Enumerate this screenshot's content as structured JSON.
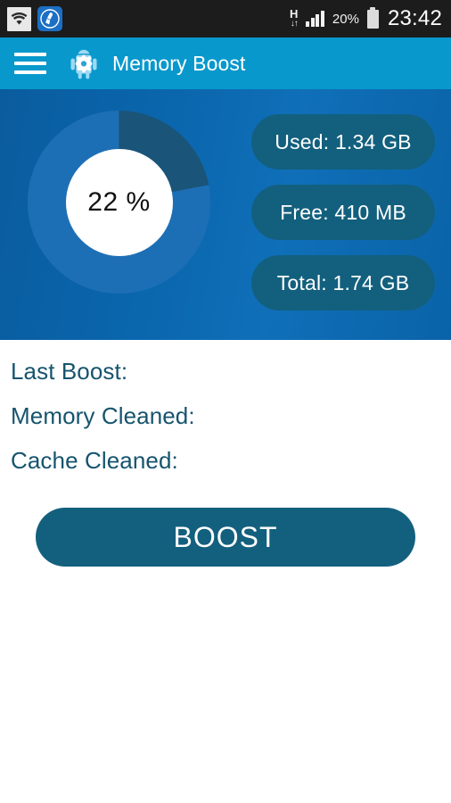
{
  "statusbar": {
    "wifi_icon": "wifi-icon",
    "cleaner_icon": "cleaner-app-icon",
    "data_type": "H",
    "data_arrows": "↓↑",
    "signal_icon": "signal-bars-icon",
    "battery_percent": "20%",
    "battery_icon": "battery-icon",
    "clock": "23:42"
  },
  "appbar": {
    "menu_icon": "hamburger-menu-icon",
    "app_icon": "android-gear-icon",
    "title": "Memory Boost",
    "background_color": "#0898cc"
  },
  "hero": {
    "background_color": "#0a66ad",
    "donut": {
      "percent_label": "22 %",
      "used_color": "#1a5479",
      "free_color": "#1d6fb5",
      "hole_color": "#ffffff"
    },
    "stats": [
      {
        "name": "used",
        "label": "Used: 1.34 GB"
      },
      {
        "name": "free",
        "label": "Free: 410 MB"
      },
      {
        "name": "total",
        "label": "Total: 1.74 GB"
      }
    ],
    "pill_color": "#13607e"
  },
  "info": {
    "rows": [
      {
        "name": "last-boost",
        "label": "Last Boost:",
        "value": ""
      },
      {
        "name": "memory-cleaned",
        "label": "Memory Cleaned:",
        "value": ""
      },
      {
        "name": "cache-cleaned",
        "label": "Cache Cleaned:",
        "value": ""
      }
    ],
    "text_color": "#16546e"
  },
  "actions": {
    "boost_label": "BOOST",
    "boost_color": "#13607e"
  },
  "chart_data": {
    "type": "pie",
    "title": "Memory usage",
    "categories": [
      "Used",
      "Free"
    ],
    "values": [
      22,
      78
    ],
    "units": "percent",
    "labels": [
      "1.34 GB",
      "410 MB"
    ],
    "total": "1.74 GB",
    "center_label": "22 %",
    "colors": [
      "#1a5479",
      "#1d6fb5"
    ],
    "legend": "right",
    "donut_hole_ratio": 0.585
  }
}
